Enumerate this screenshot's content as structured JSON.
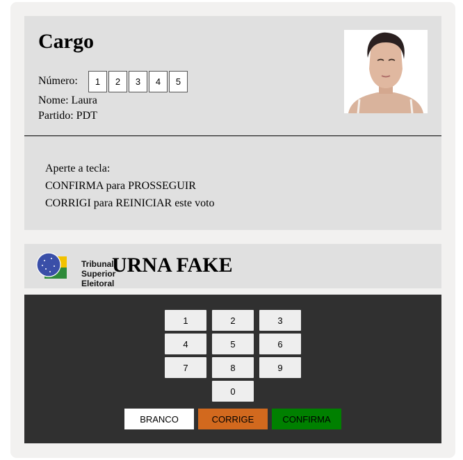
{
  "screen": {
    "title": "Cargo",
    "number_label": "Número:",
    "digits": [
      "1",
      "2",
      "3",
      "4",
      "5"
    ],
    "name_line": "Nome: Laura",
    "party_line": "Partido: PDT",
    "instructions": [
      "Aperte a tecla:",
      "CONFIRMA para PROSSEGUIR",
      "CORRIGI para REINICIAR este voto"
    ]
  },
  "brand": {
    "logo_lines": [
      "Tribunal",
      "Superior",
      "Eleitoral"
    ],
    "title": "URNA FAKE"
  },
  "keypad": {
    "keys": [
      "1",
      "2",
      "3",
      "4",
      "5",
      "6",
      "7",
      "8",
      "9",
      "0"
    ],
    "branco": "BRANCO",
    "corrige": "CORRIGE",
    "confirma": "CONFIRMA"
  },
  "colors": {
    "corrige": "#d2691e",
    "confirma": "#008000",
    "keypad_bg": "#303030",
    "screen_bg": "#e0e0e0"
  }
}
